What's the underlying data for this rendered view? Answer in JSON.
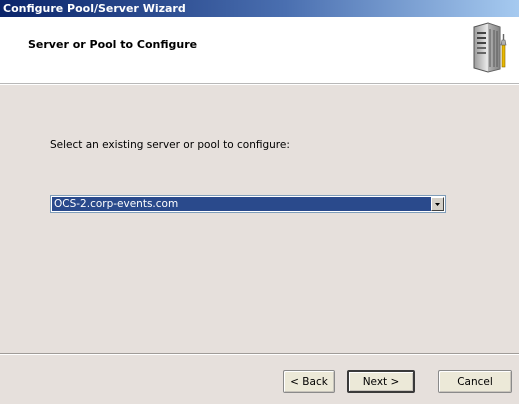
{
  "window": {
    "title": "Configure Pool/Server Wizard"
  },
  "header": {
    "title": "Server or Pool to Configure",
    "icon": "server-tools-icon"
  },
  "content": {
    "prompt": "Select an existing server or pool to configure:",
    "server_select": {
      "selected_value": "OCS-2.corp-events.com",
      "icon": "chevron-down-icon"
    }
  },
  "buttons": {
    "back": "< Back",
    "next": "Next >",
    "cancel": "Cancel"
  },
  "colors": {
    "titlebar": "#0a246a",
    "content_bg": "#e6e0dc",
    "selection": "#2a4a8c"
  }
}
